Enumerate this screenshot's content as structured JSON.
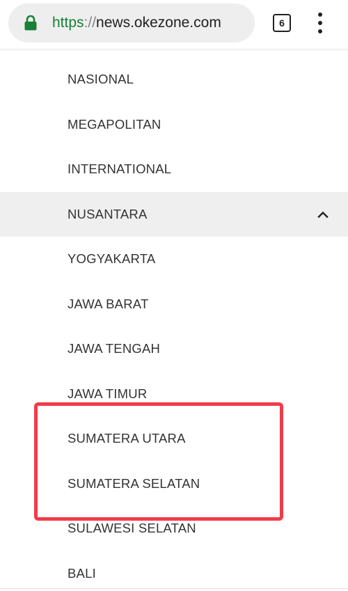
{
  "browser": {
    "url_scheme": "https",
    "url_separator": "://",
    "url_host": "news.okezone.com",
    "tab_count": "6",
    "secure_icon": "lock-icon",
    "menu_icon": "more-vert-icon"
  },
  "nav": {
    "items": [
      {
        "label": "NASIONAL"
      },
      {
        "label": "MEGAPOLITAN"
      },
      {
        "label": "INTERNATIONAL"
      },
      {
        "label": "NUSANTARA",
        "expanded": true,
        "icon": "chevron-up-icon"
      },
      {
        "label": "YOGYAKARTA"
      },
      {
        "label": "JAWA BARAT"
      },
      {
        "label": "JAWA TENGAH"
      },
      {
        "label": "JAWA TIMUR"
      },
      {
        "label": "SUMATERA UTARA"
      },
      {
        "label": "SUMATERA SELATAN"
      },
      {
        "label": "SULAWESI SELATAN"
      },
      {
        "label": "BALI"
      }
    ]
  },
  "colors": {
    "secure_green": "#188038",
    "highlight_red": "#f03c4a",
    "expanded_bg": "#efefef"
  }
}
